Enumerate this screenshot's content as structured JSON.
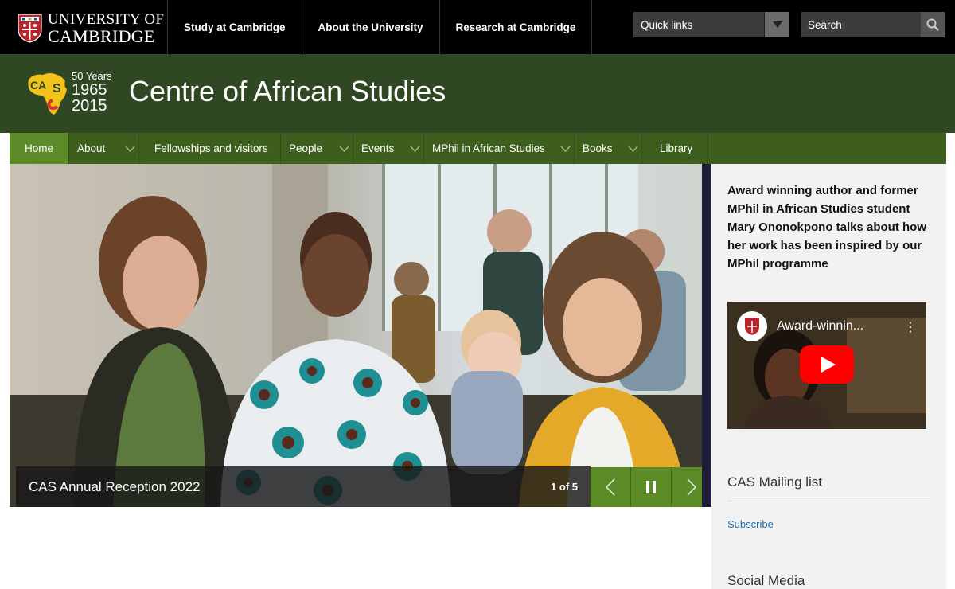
{
  "global": {
    "logo_line1": "UNIVERSITY OF",
    "logo_line2": "CAMBRIDGE",
    "nav": [
      "Study at Cambridge",
      "About the University",
      "Research at Cambridge"
    ],
    "quick_links_label": "Quick links",
    "search_placeholder": "Search"
  },
  "department": {
    "years_label": "50 Years",
    "year_start": "1965",
    "year_end": "2015",
    "title": "Centre of African Studies"
  },
  "site_nav": [
    {
      "label": "Home",
      "active": true,
      "dropdown": false
    },
    {
      "label": "About",
      "dropdown": true
    },
    {
      "label": "Fellowships and visitors",
      "dropdown": false
    },
    {
      "label": "People",
      "dropdown": true
    },
    {
      "label": "Events",
      "dropdown": true
    },
    {
      "label": "MPhil in African Studies",
      "dropdown": true
    },
    {
      "label": "Books",
      "dropdown": true
    },
    {
      "label": "Library",
      "dropdown": false
    }
  ],
  "carousel": {
    "caption": "CAS Annual Reception 2022",
    "counter": "1 of 5"
  },
  "sidebar": {
    "featured_text": "Award winning author and former MPhil in African Studies student Mary Ononokpono talks about how her work has been inspired by our MPhil programme",
    "video_title": "Award-winnin...",
    "mailing_title": "CAS Mailing list",
    "subscribe_label": "Subscribe",
    "social_title": "Social Media"
  },
  "colors": {
    "topbar": "#000000",
    "dept_header": "#2f4722",
    "nav_bg": "#3e5e1e",
    "nav_active": "#5d8b29",
    "control_green": "#5b8b27",
    "link_blue": "#1f6fb5"
  }
}
